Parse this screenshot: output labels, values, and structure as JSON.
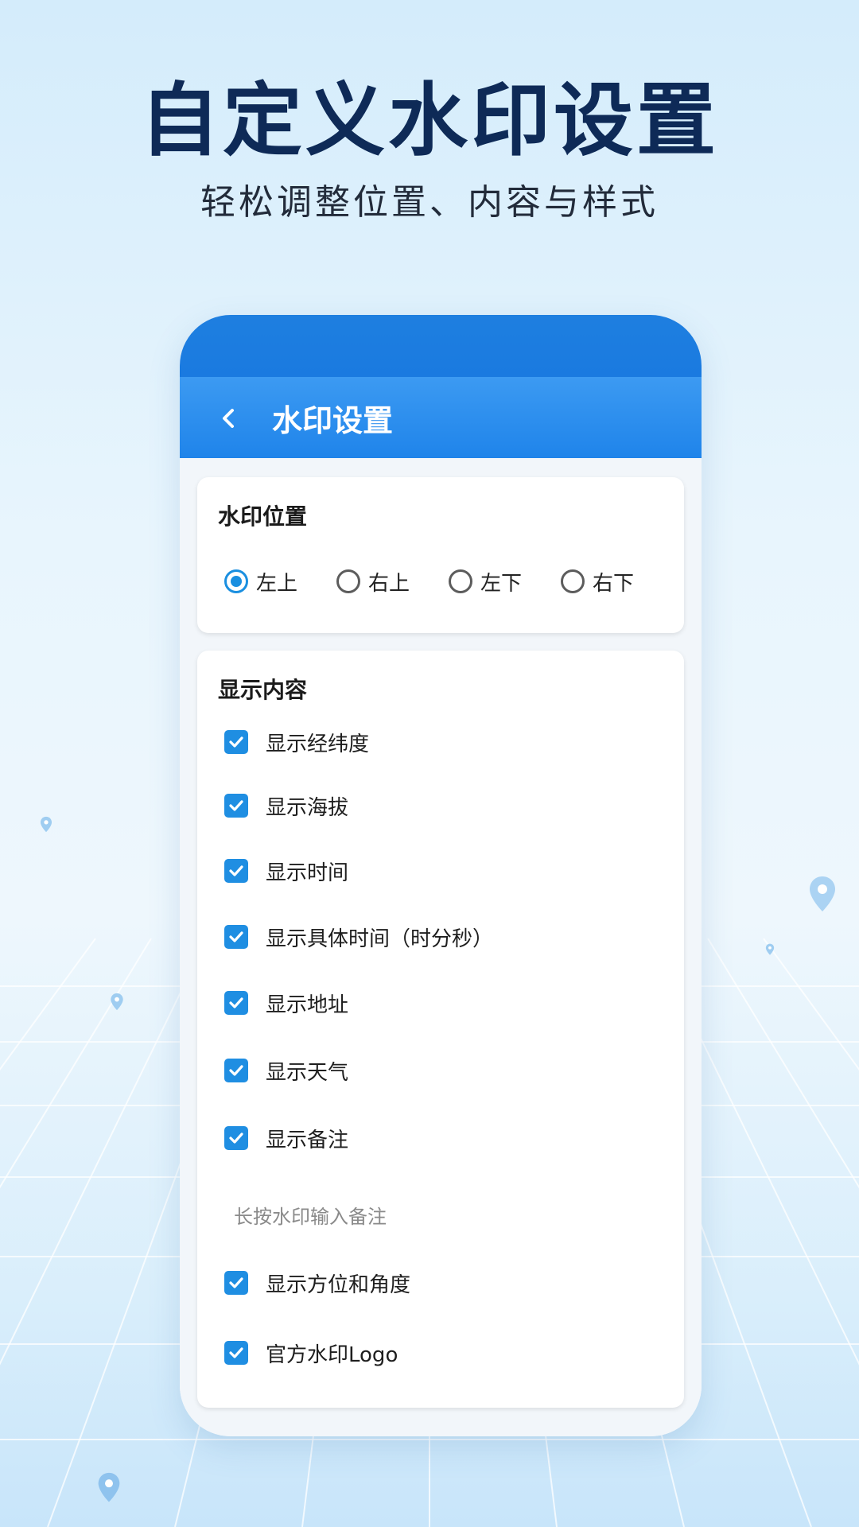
{
  "hero": {
    "title": "自定义水印设置",
    "subtitle": "轻松调整位置、内容与样式"
  },
  "appbar": {
    "back_icon": "chevron-left-icon",
    "title": "水印设置"
  },
  "position_card": {
    "title": "水印位置",
    "options": [
      {
        "label": "左上",
        "selected": true
      },
      {
        "label": "右上",
        "selected": false
      },
      {
        "label": "左下",
        "selected": false
      },
      {
        "label": "右下",
        "selected": false
      }
    ]
  },
  "content_card": {
    "title": "显示内容",
    "items": [
      {
        "label": "显示经纬度",
        "checked": true
      },
      {
        "label": "显示海拔",
        "checked": true
      },
      {
        "label": "显示时间",
        "checked": true
      },
      {
        "label": "显示具体时间（时分秒）",
        "checked": true
      },
      {
        "label": "显示地址",
        "checked": true
      },
      {
        "label": "显示天气",
        "checked": true
      },
      {
        "label": "显示备注",
        "checked": true
      },
      {
        "label": "显示方位和角度",
        "checked": true
      },
      {
        "label": "官方水印Logo",
        "checked": true
      }
    ],
    "hint": "长按水印输入备注"
  },
  "colors": {
    "accent": "#1f8ee2",
    "appbar": "#2a8cec",
    "title": "#0e2a57"
  }
}
